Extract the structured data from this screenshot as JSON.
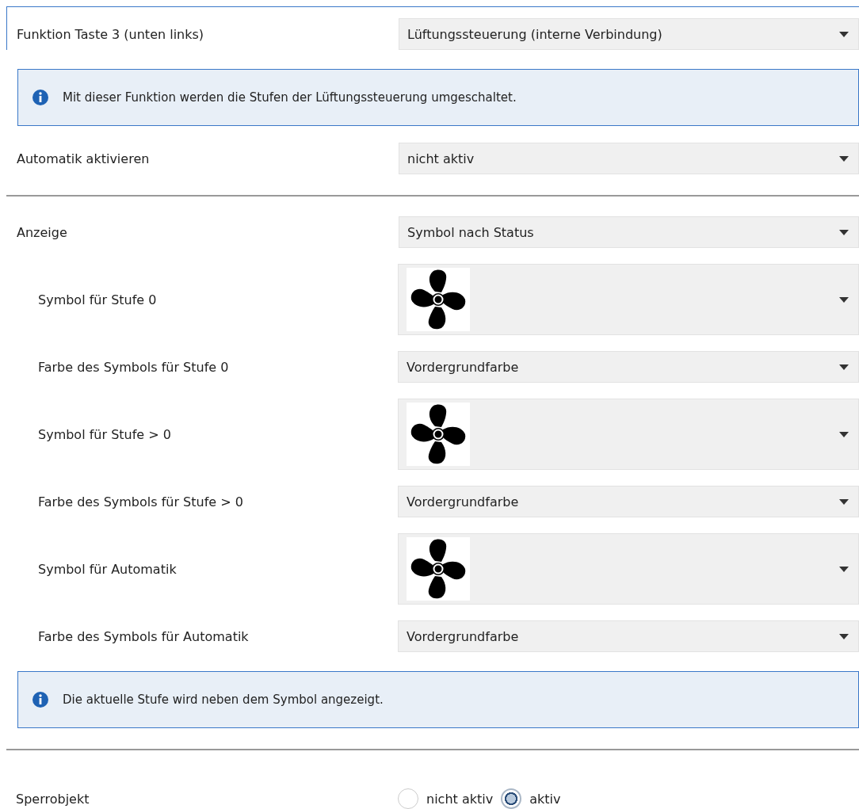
{
  "rows": [
    {
      "kind": "select",
      "label": "Funktion Taste 3 (unten links)",
      "value": "Lüftungssteuerung (interne Verbindung)",
      "focused": true
    },
    {
      "kind": "info",
      "text": "Mit dieser Funktion werden die Stufen der Lüftungssteuerung umgeschaltet."
    },
    {
      "kind": "select",
      "label": "Automatik aktivieren",
      "value": "nicht aktiv",
      "focused": false
    },
    {
      "kind": "divider"
    },
    {
      "kind": "select",
      "label": "Anzeige",
      "value": "Symbol nach Status",
      "focused": false,
      "children": [
        {
          "kind": "icon",
          "label": "Symbol für Stufe 0"
        },
        {
          "kind": "select",
          "label": "Farbe des Symbols für Stufe 0",
          "value": "Vordergrundfarbe"
        },
        {
          "kind": "icon",
          "label": "Symbol für Stufe > 0"
        },
        {
          "kind": "select",
          "label": "Farbe des Symbols für Stufe > 0",
          "value": "Vordergrundfarbe"
        },
        {
          "kind": "icon",
          "label": "Symbol für Automatik"
        },
        {
          "kind": "select",
          "label": "Farbe des Symbols für Automatik",
          "value": "Vordergrundfarbe"
        }
      ]
    },
    {
      "kind": "info",
      "text": "Die aktuelle Stufe wird neben dem Symbol angezeigt."
    },
    {
      "kind": "divider"
    },
    {
      "kind": "radio",
      "label": "Sperrobjekt",
      "options": [
        {
          "label": "nicht aktiv",
          "selected": false
        },
        {
          "label": "aktiv",
          "selected": true
        }
      ]
    }
  ]
}
